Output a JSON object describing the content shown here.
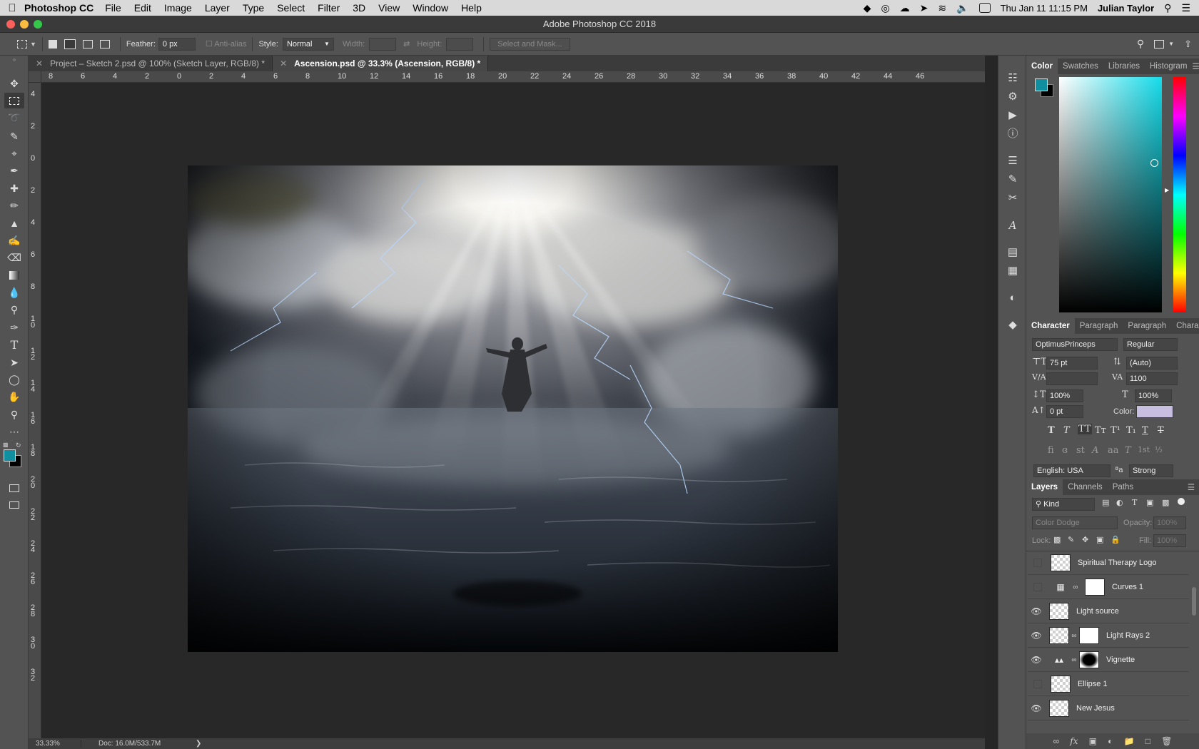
{
  "menubar": {
    "app_name": "Photoshop CC",
    "items": [
      "File",
      "Edit",
      "Image",
      "Layer",
      "Type",
      "Select",
      "Filter",
      "3D",
      "View",
      "Window",
      "Help"
    ],
    "clock": "Thu Jan 11  11:15 PM",
    "user": "Julian Taylor"
  },
  "window": {
    "title": "Adobe Photoshop CC 2018"
  },
  "options": {
    "feather_label": "Feather:",
    "feather_value": "0 px",
    "antialias_label": "Anti-alias",
    "style_label": "Style:",
    "style_value": "Normal",
    "width_label": "Width:",
    "height_label": "Height:",
    "select_mask": "Select and Mask..."
  },
  "tabs": [
    {
      "label": "Project – Sketch 2.psd @ 100% (Sketch Layer, RGB/8) *",
      "active": false
    },
    {
      "label": "Ascension.psd @ 33.3% (Ascension, RGB/8) *",
      "active": true
    }
  ],
  "rulers": {
    "h_ticks": [
      "8",
      "6",
      "4",
      "2",
      "0",
      "2",
      "4",
      "6",
      "8",
      "10",
      "12",
      "14",
      "16",
      "18",
      "20",
      "22",
      "24",
      "26",
      "28",
      "30",
      "32",
      "34",
      "36",
      "38",
      "40",
      "42",
      "44",
      "46"
    ],
    "v_ticks": [
      "4",
      "2",
      "0",
      "2",
      "4",
      "6",
      "8",
      "1 0",
      "1 2",
      "1 4",
      "1 6",
      "1 8",
      "2 0",
      "2 2",
      "2 4",
      "2 6",
      "2 8",
      "3 0",
      "3 2"
    ]
  },
  "status": {
    "zoom": "33.33%",
    "doc": "Doc: 16.0M/533.7M"
  },
  "color_panel": {
    "tabs": [
      "Color",
      "Swatches",
      "Libraries",
      "Histogram"
    ],
    "fg_color": "#0f8fa0",
    "bg_color": "#000000"
  },
  "character_panel": {
    "tabs": [
      "Character",
      "Paragraph",
      "Paragraph",
      "Character"
    ],
    "font_family": "OptimusPrinceps",
    "font_style": "Regular",
    "size": "75 pt",
    "leading": "(Auto)",
    "kerning": "",
    "tracking": "1100",
    "vscale": "100%",
    "hscale": "100%",
    "baseline": "0 pt",
    "color_label": "Color:",
    "text_color": "#c8bfe0",
    "language": "English: USA",
    "antialias": "Strong"
  },
  "layers_panel": {
    "tabs": [
      "Layers",
      "Channels",
      "Paths"
    ],
    "filter_kind": "Kind",
    "blend_mode": "Color Dodge",
    "opacity_label": "Opacity:",
    "opacity_value": "100%",
    "lock_label": "Lock:",
    "fill_label": "Fill:",
    "fill_value": "100%",
    "layers": [
      {
        "name": "Spiritual Therapy Logo",
        "visible": false,
        "mask": false,
        "type": "smart"
      },
      {
        "name": "Curves 1",
        "visible": false,
        "mask": true,
        "type": "adjustment"
      },
      {
        "name": "Light source",
        "visible": true,
        "mask": false,
        "type": "pixel"
      },
      {
        "name": "Light Rays 2",
        "visible": true,
        "mask": true,
        "type": "pixel"
      },
      {
        "name": "Vignette",
        "visible": true,
        "mask": true,
        "type": "levels"
      },
      {
        "name": "Ellipse 1",
        "visible": false,
        "mask": false,
        "type": "pixel"
      },
      {
        "name": "New Jesus",
        "visible": true,
        "mask": false,
        "type": "pixel"
      }
    ]
  }
}
